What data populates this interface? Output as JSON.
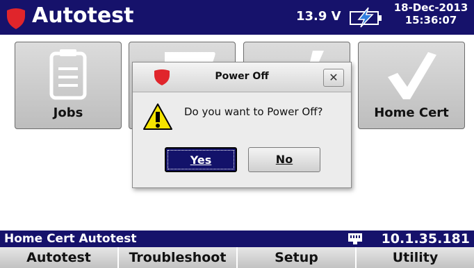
{
  "title_bar": {
    "app_title": "Autotest",
    "voltage": "13.9 V",
    "date": "18-Dec-2013",
    "time": "15:36:07",
    "accent_color": "#16126b",
    "logo_color": "#e0252b"
  },
  "tiles": [
    {
      "label": "Jobs",
      "icon": "clipboard-icon"
    },
    {
      "label": "",
      "icon": "obscured-tile-icon"
    },
    {
      "label": "",
      "icon": "checkmark-icon"
    },
    {
      "label": "Home Cert",
      "icon": "checkmark-icon"
    }
  ],
  "dialog": {
    "title": "Power Off",
    "close_label": "✕",
    "message": "Do you want to Power Off?",
    "yes_label": "Yes",
    "no_label": "No",
    "icon": "warning-icon"
  },
  "status_bar": {
    "left_text": "Home Cert Autotest",
    "ip_address": "10.1.35.181",
    "icon": "network-icon"
  },
  "tabs": [
    "Autotest",
    "Troubleshoot",
    "Setup",
    "Utility"
  ]
}
